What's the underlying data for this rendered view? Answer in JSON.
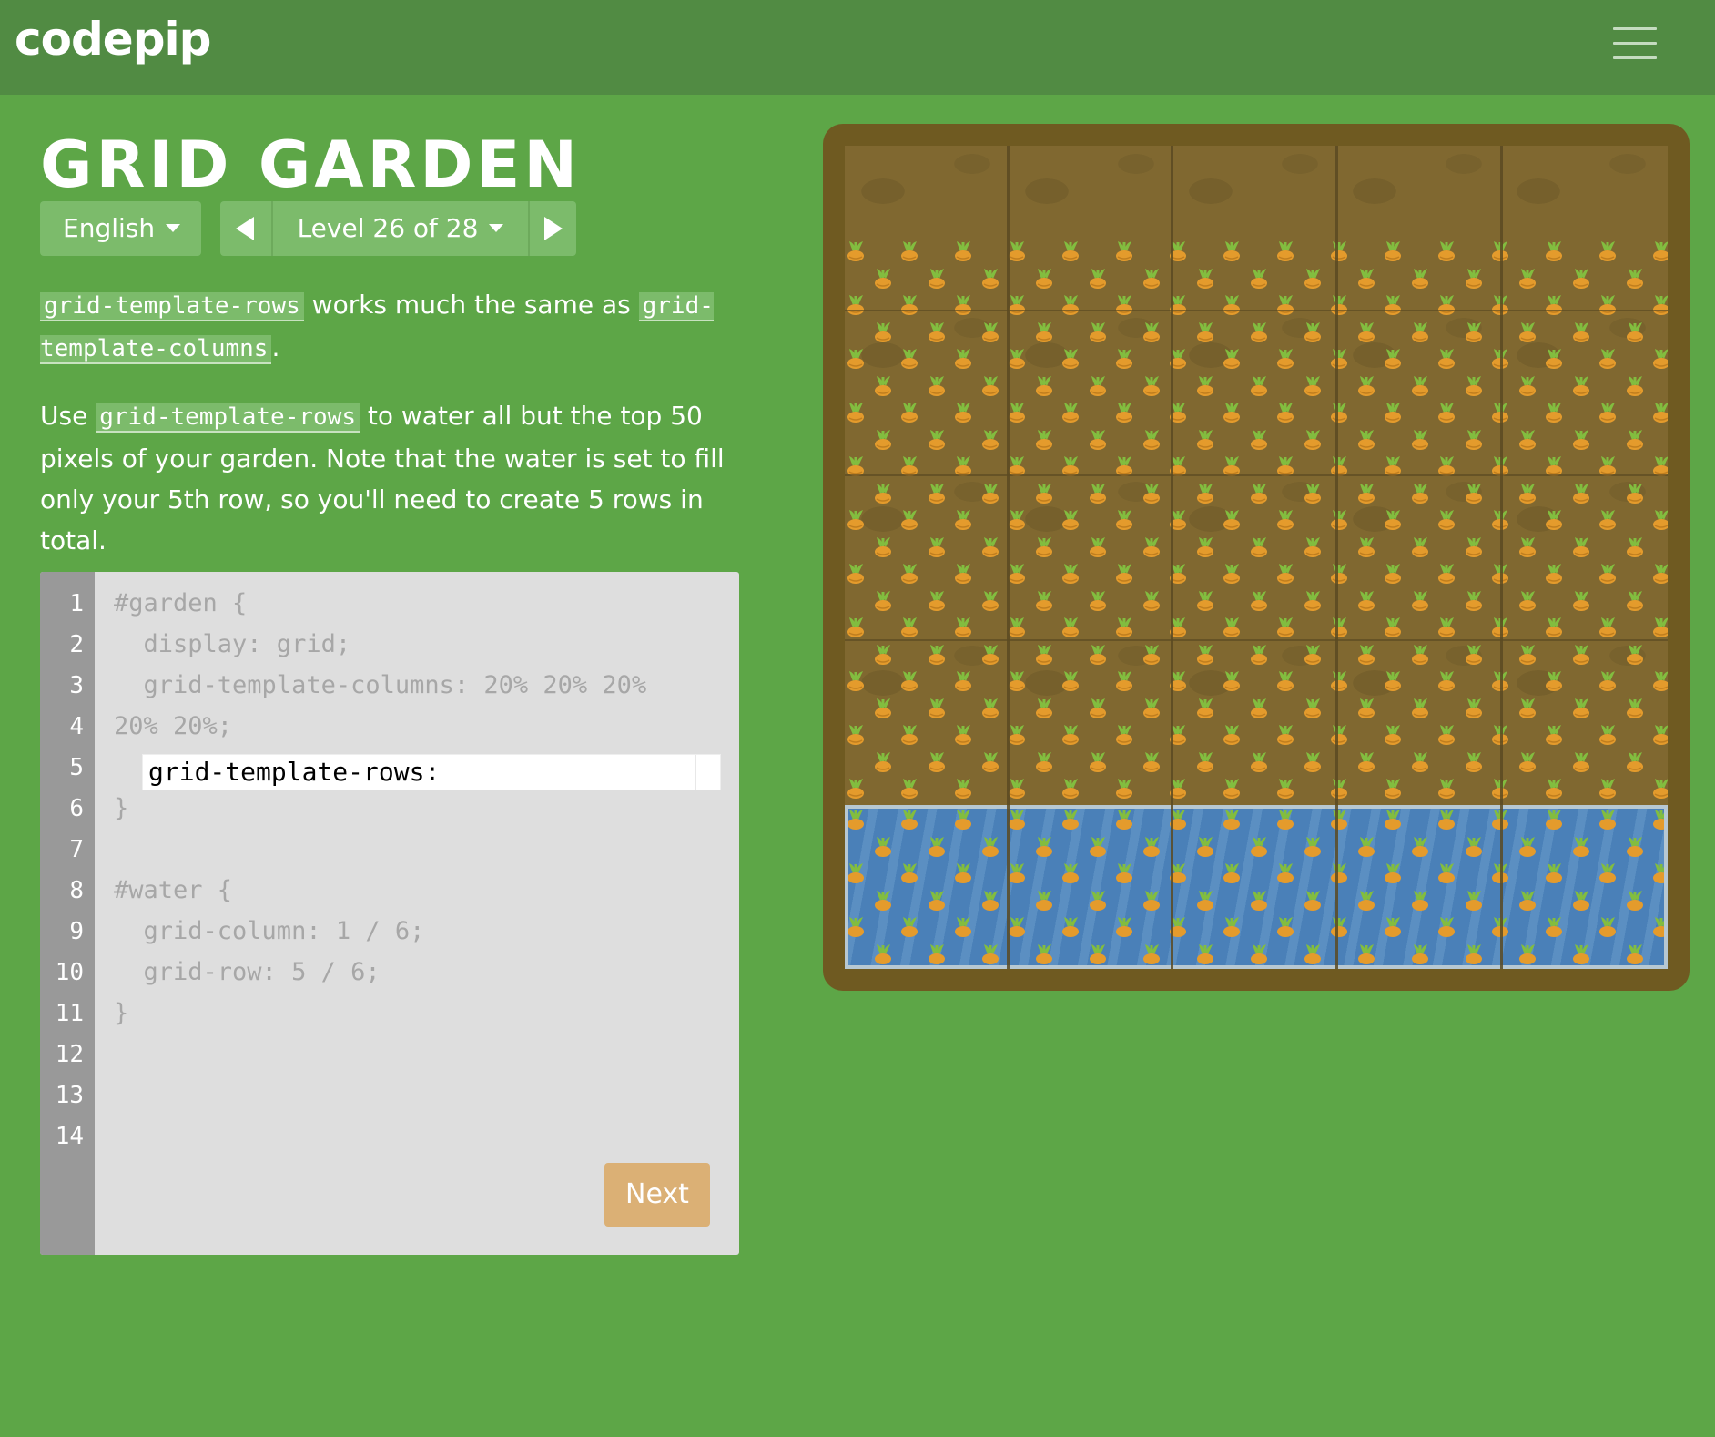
{
  "header": {
    "logo": "codepip",
    "menu_icon": "hamburger-menu-icon"
  },
  "game": {
    "title": "GRID GARDEN",
    "language": "English",
    "level_label": "Level 26 of 28",
    "prev_icon": "triangle-left-icon",
    "next_icon": "triangle-right-icon"
  },
  "instructions": {
    "p1": {
      "code_a": "grid-template-rows",
      "text_a": " works much the same as ",
      "code_b": "grid-template-columns",
      "text_b": "."
    },
    "p2": {
      "text_a": "Use ",
      "code_a": "grid-template-rows",
      "text_b": " to water all but the top 50 pixels of your garden. Note that the water is set to fill only your 5th row, so you'll need to create 5 rows in total."
    }
  },
  "editor": {
    "line_numbers": [
      "1",
      "2",
      "3",
      "4",
      "5",
      "6",
      "7",
      "8",
      "9",
      "10",
      "11",
      "12",
      "13",
      "14"
    ],
    "code_lines": {
      "l1": "#garden {",
      "l2": "  display: grid;",
      "l3": "  grid-template-columns: 20% 20% 20%",
      "l4": "20% 20%;",
      "l6": "}",
      "l8": "#water {",
      "l9": "  grid-column: 1 / 6;",
      "l10": "  grid-row: 5 / 6;",
      "l11": "}"
    },
    "input_value": "grid-template-rows:",
    "next_label": "Next"
  },
  "colors": {
    "background": "#5da647",
    "header": "#518b43",
    "soil": "#806830",
    "frame": "#6f5a21",
    "water": "#4a80b8",
    "carrot": "#e49b2c",
    "leaf": "#82bd3f",
    "next_button": "#dbb075"
  }
}
